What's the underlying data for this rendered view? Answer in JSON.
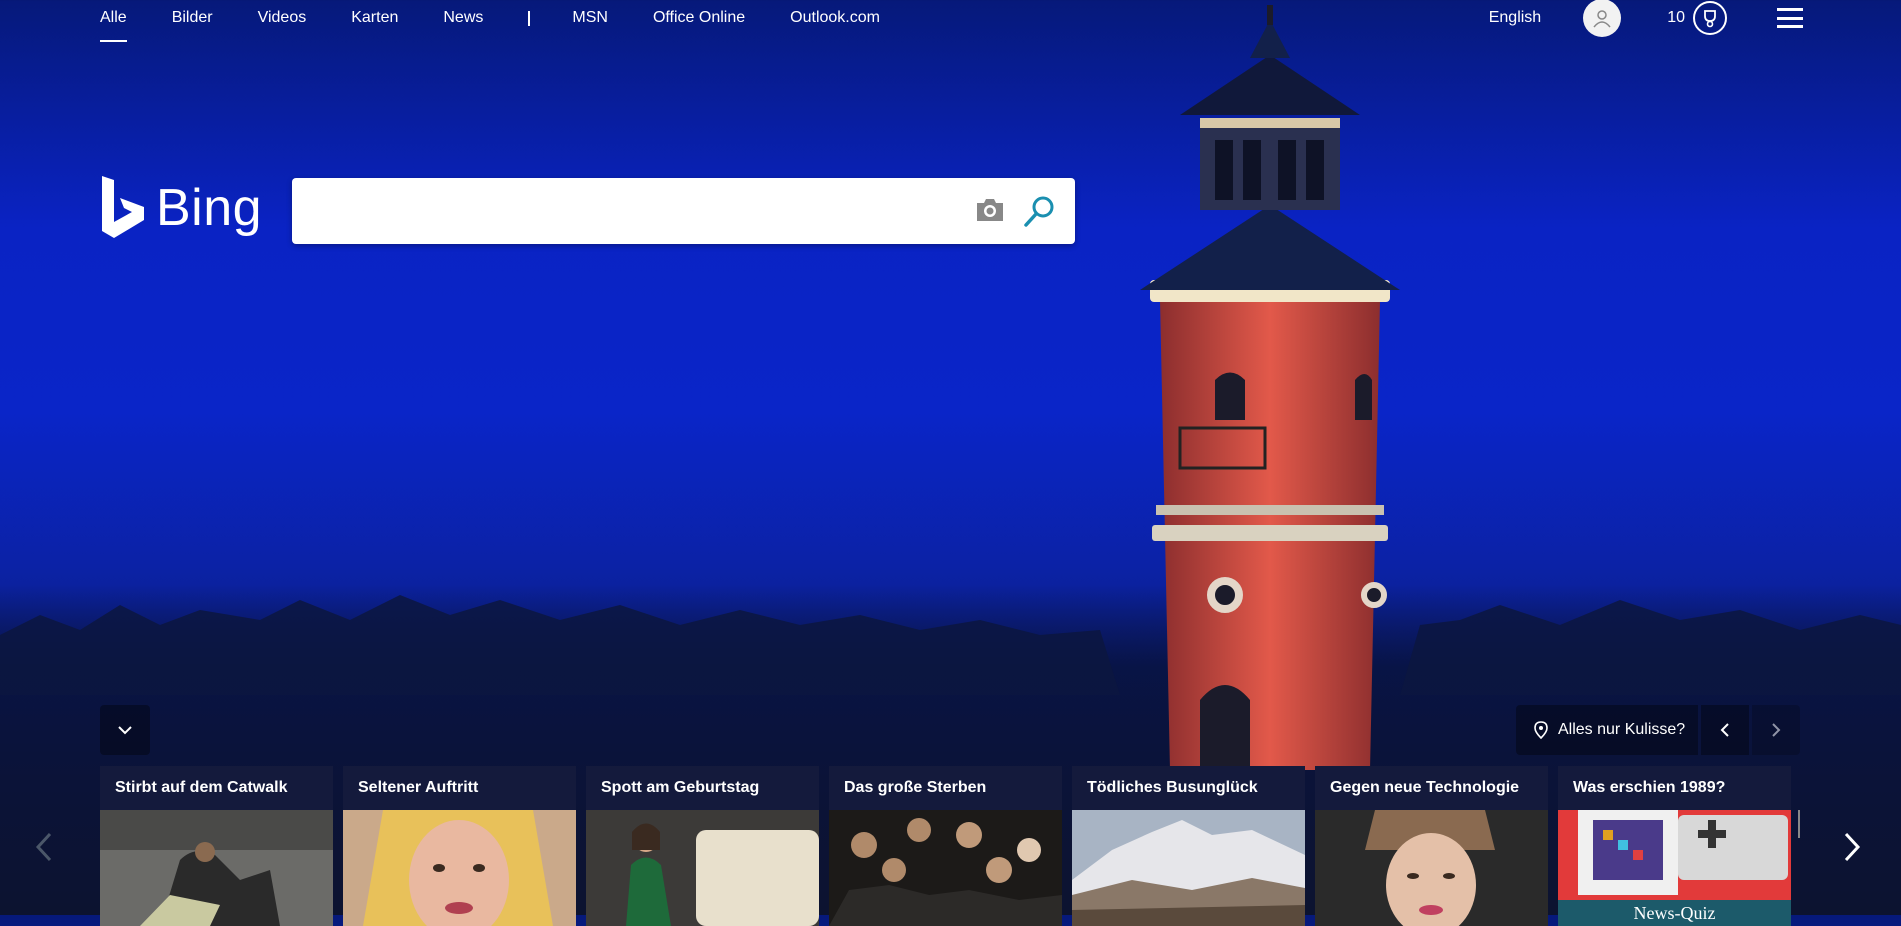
{
  "nav": {
    "items": [
      {
        "label": "Alle",
        "active": true
      },
      {
        "label": "Bilder"
      },
      {
        "label": "Videos"
      },
      {
        "label": "Karten"
      },
      {
        "label": "News"
      }
    ],
    "external": [
      {
        "label": "MSN"
      },
      {
        "label": "Office Online"
      },
      {
        "label": "Outlook.com"
      }
    ]
  },
  "header": {
    "language": "English",
    "reward_points": "10"
  },
  "logo": {
    "text": "Bing"
  },
  "search": {
    "value": "",
    "placeholder": ""
  },
  "image_info": {
    "label": "Alles nur Kulisse?"
  },
  "cards": [
    {
      "title": "Stirbt auf dem Catwalk",
      "image": "fashion-show-scene"
    },
    {
      "title": "Seltener Auftritt",
      "image": "blonde-woman-portrait"
    },
    {
      "title": "Spott am Geburtstag",
      "image": "woman-green-coat-sofa"
    },
    {
      "title": "Das große Sterben",
      "image": "tv-series-cast"
    },
    {
      "title": "Tödliches Busunglück",
      "image": "mountain-landscape"
    },
    {
      "title": "Gegen neue Technologie",
      "image": "singer-portrait"
    },
    {
      "title": "Was erschien 1989?",
      "image": "game-console",
      "label": "News-Quiz"
    }
  ],
  "colors": {
    "background_top": "#06197a",
    "background_mid": "#0a25c8",
    "search_icon": "#1a8fb0",
    "lighthouse_brick": "#d2503f"
  }
}
